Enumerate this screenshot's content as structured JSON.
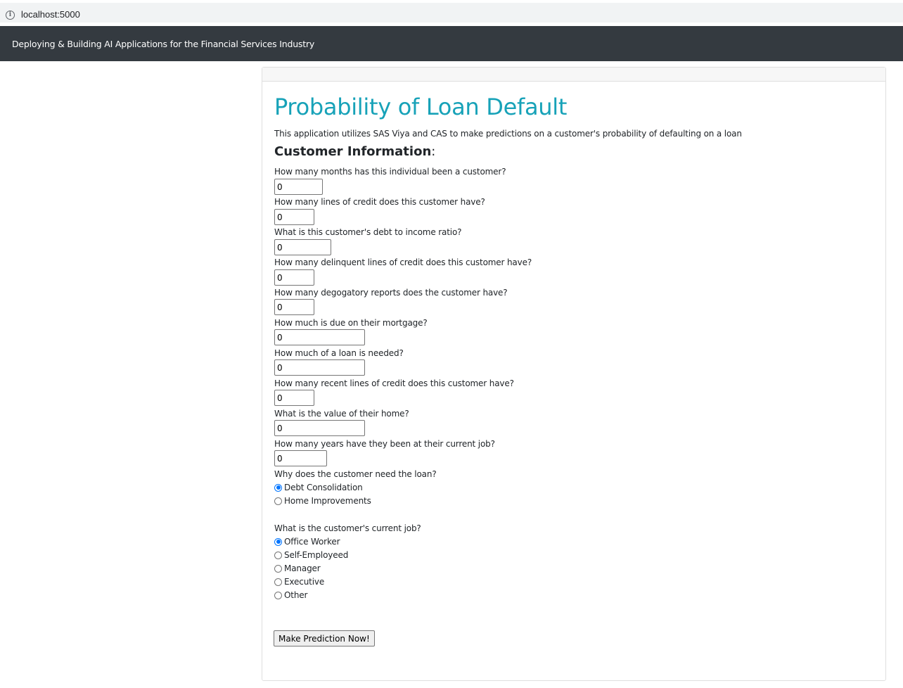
{
  "browser": {
    "url": "localhost:5000"
  },
  "navbar": {
    "brand": "Deploying & Building AI Applications for the Financial Services Industry"
  },
  "main": {
    "title": "Probability of Loan Default",
    "subtitle": "This application utilizes SAS Viya and CAS to make predictions on a customer's probability of defaulting on a loan",
    "section_title": "Customer Information",
    "section_colon": ":",
    "questions": [
      {
        "label": "How many months has this individual been a customer?",
        "value": "0"
      },
      {
        "label": "How many lines of credit does this customer have?",
        "value": "0"
      },
      {
        "label": "What is this customer's debt to income ratio?",
        "value": "0"
      },
      {
        "label": "How many delinquent lines of credit does this customer have?",
        "value": "0"
      },
      {
        "label": "How many degogatory reports does the customer have?",
        "value": "0"
      },
      {
        "label": "How much is due on their mortgage?",
        "value": "0"
      },
      {
        "label": "How much of a loan is needed?",
        "value": "0"
      },
      {
        "label": "How many recent lines of credit does this customer have?",
        "value": "0"
      },
      {
        "label": "What is the value of their home?",
        "value": "0"
      },
      {
        "label": "How many years have they been at their current job?",
        "value": "0"
      }
    ],
    "reason": {
      "label": "Why does the customer need the loan?",
      "options": [
        "Debt Consolidation",
        "Home Improvements"
      ],
      "selected": "Debt Consolidation"
    },
    "job": {
      "label": "What is the customer's current job?",
      "options": [
        "Office Worker",
        "Self-Employeed",
        "Manager",
        "Executive",
        "Other"
      ],
      "selected": "Office Worker"
    },
    "submit_label": "Make Prediction Now!"
  },
  "colors": {
    "navbar_bg": "#343a40",
    "title": "#17a2b8",
    "radio_checked": "#0075ff"
  }
}
